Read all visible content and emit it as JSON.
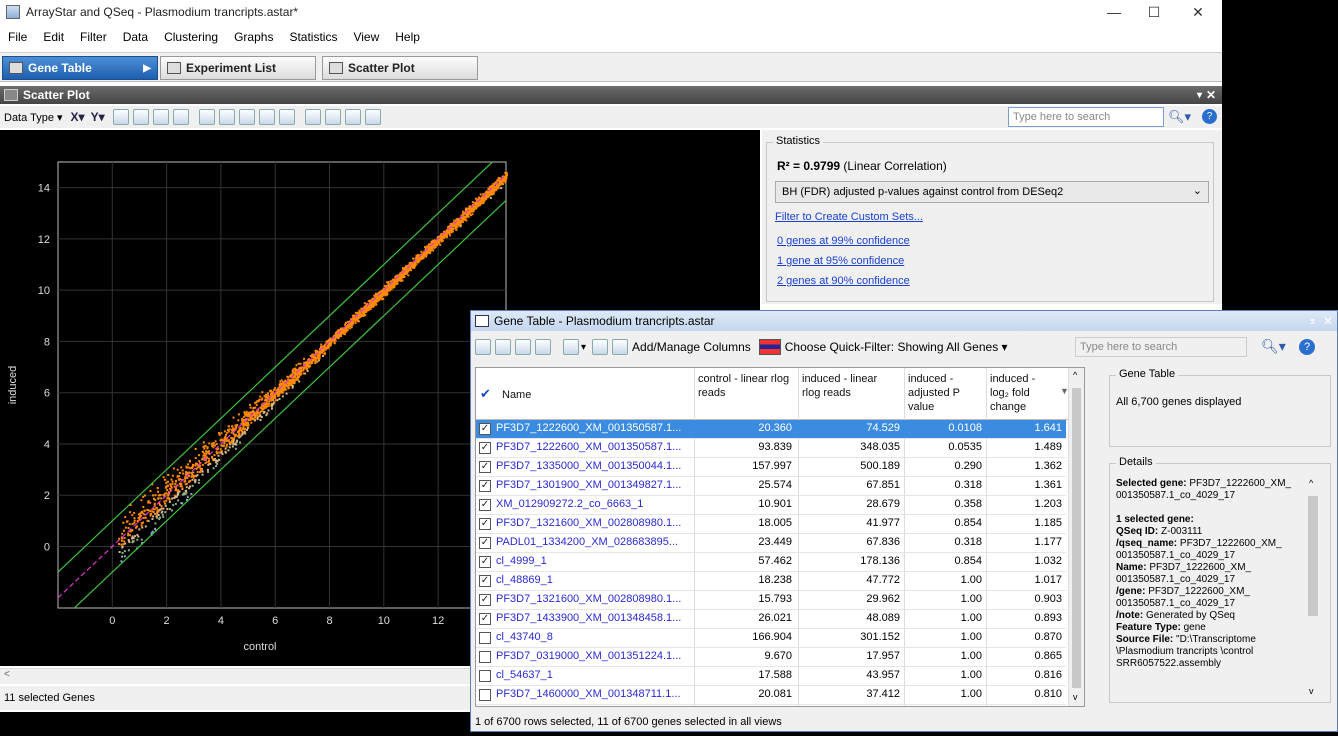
{
  "app": {
    "title": "ArrayStar and QSeq - Plasmodium trancripts.astar*"
  },
  "menu": [
    "File",
    "Edit",
    "Filter",
    "Data",
    "Clustering",
    "Graphs",
    "Statistics",
    "View",
    "Help"
  ],
  "view_tabs": [
    {
      "label": "Gene Table"
    },
    {
      "label": "Experiment List"
    },
    {
      "label": "Scatter Plot"
    }
  ],
  "scatter": {
    "title": "Scatter Plot",
    "data_type_label": "Data Type",
    "search_placeholder": "Type here to search",
    "status": "11 selected Genes"
  },
  "statistics": {
    "group_title": "Statistics",
    "r2_label": "R² = 0.9799",
    "r2_desc": "(Linear Correlation)",
    "method_select": "BH (FDR) adjusted p-values against control from DESeq2",
    "filter_link": "Filter to Create Custom Sets...",
    "confidence_links": [
      "0 genes at 99% confidence",
      "1 gene at 95% confidence",
      "2 genes at 90% confidence"
    ]
  },
  "chart_data": {
    "type": "scatter",
    "xlabel": "control",
    "ylabel": "induced",
    "xlim": [
      -2,
      14.5
    ],
    "ylim": [
      -2.4,
      15
    ],
    "xticks": [
      0,
      2,
      4,
      6,
      8,
      10,
      12
    ],
    "yticks": [
      0,
      2,
      4,
      6,
      8,
      10,
      12,
      14
    ],
    "grid": true,
    "reference_lines": [
      {
        "name": "fit",
        "style": "dashed magenta",
        "slope": 1,
        "intercept": 0
      },
      {
        "name": "upper bound",
        "style": "green",
        "offset": 1
      },
      {
        "name": "lower bound",
        "style": "green",
        "offset": -1
      }
    ],
    "point_cloud": {
      "x_range": [
        0.2,
        14.5
      ],
      "trend": "y ≈ x",
      "colors": [
        "#ff8a00",
        "#d9b98a",
        "#8fb08a",
        "#9aa0d0"
      ]
    }
  },
  "gene_table": {
    "title": "Gene Table - Plasmodium trancripts.astar",
    "add_columns_label": "Add/Manage Columns",
    "quick_filter_label": "Choose Quick-Filter: Showing All Genes",
    "search_placeholder": "Type here to search",
    "columns": [
      "Name",
      "control - linear rlog reads",
      "induced - linear rlog reads",
      "induced - adjusted P value",
      "induced - log₂ fold change"
    ],
    "rows": [
      {
        "checked": true,
        "name": "PF3D7_1222600_XM_001350587.1...",
        "c": "20.360",
        "i": "74.529",
        "p": "0.0108",
        "fc": "1.641",
        "sel": true
      },
      {
        "checked": true,
        "name": "PF3D7_1222600_XM_001350587.1...",
        "c": "93.839",
        "i": "348.035",
        "p": "0.0535",
        "fc": "1.489"
      },
      {
        "checked": true,
        "name": "PF3D7_1335000_XM_001350044.1...",
        "c": "157.997",
        "i": "500.189",
        "p": "0.290",
        "fc": "1.362"
      },
      {
        "checked": true,
        "name": "PF3D7_1301900_XM_001349827.1...",
        "c": "25.574",
        "i": "67.851",
        "p": "0.318",
        "fc": "1.361"
      },
      {
        "checked": true,
        "name": "XM_012909272.2_co_6663_1",
        "c": "10.901",
        "i": "28.679",
        "p": "0.358",
        "fc": "1.203"
      },
      {
        "checked": true,
        "name": "PF3D7_1321600_XM_002808980.1...",
        "c": "18.005",
        "i": "41.977",
        "p": "0.854",
        "fc": "1.185"
      },
      {
        "checked": true,
        "name": "PADL01_1334200_XM_028683895...",
        "c": "23.449",
        "i": "67.836",
        "p": "0.318",
        "fc": "1.177"
      },
      {
        "checked": true,
        "name": "cl_4999_1",
        "c": "57.462",
        "i": "178.136",
        "p": "0.854",
        "fc": "1.032"
      },
      {
        "checked": true,
        "name": "cl_48869_1",
        "c": "18.238",
        "i": "47.772",
        "p": "1.00",
        "fc": "1.017"
      },
      {
        "checked": true,
        "name": "PF3D7_1321600_XM_002808980.1...",
        "c": "15.793",
        "i": "29.962",
        "p": "1.00",
        "fc": "0.903"
      },
      {
        "checked": true,
        "name": "PF3D7_1433900_XM_001348458.1...",
        "c": "26.021",
        "i": "48.089",
        "p": "1.00",
        "fc": "0.893"
      },
      {
        "checked": false,
        "name": "cl_43740_8",
        "c": "166.904",
        "i": "301.152",
        "p": "1.00",
        "fc": "0.870"
      },
      {
        "checked": false,
        "name": "PF3D7_0319000_XM_001351224.1...",
        "c": "9.670",
        "i": "17.957",
        "p": "1.00",
        "fc": "0.865"
      },
      {
        "checked": false,
        "name": "cl_54637_1",
        "c": "17.588",
        "i": "43.957",
        "p": "1.00",
        "fc": "0.816"
      },
      {
        "checked": false,
        "name": "PF3D7_1460000_XM_001348711.1...",
        "c": "20.081",
        "i": "37.412",
        "p": "1.00",
        "fc": "0.810"
      }
    ],
    "side_title": "Gene Table",
    "side_text": "All 6,700 genes displayed",
    "details_title": "Details",
    "details_lines": [
      [
        "Selected gene:",
        "PF3D7_1222600_XM_ 001350587.1_co_4029_17"
      ],
      [
        "",
        ""
      ],
      [
        "1 selected gene:",
        ""
      ],
      [
        "QSeq ID:",
        "Z-003111"
      ],
      [
        "/qseq_name:",
        "PF3D7_1222600_XM_ 001350587.1_co_4029_17"
      ],
      [
        "Name:",
        "PF3D7_1222600_XM_ 001350587.1_co_4029_17"
      ],
      [
        "/gene:",
        "PF3D7_1222600_XM_ 001350587.1_co_4029_17"
      ],
      [
        "/note:",
        "Generated by QSeq"
      ],
      [
        "Feature Type:",
        "gene"
      ],
      [
        "Source File:",
        "\"D:\\Transcriptome \\Plasmodium trancripts \\control SRR6057522.assembly"
      ]
    ],
    "status": "1 of 6700 rows selected, 11 of 6700 genes selected in all views"
  }
}
